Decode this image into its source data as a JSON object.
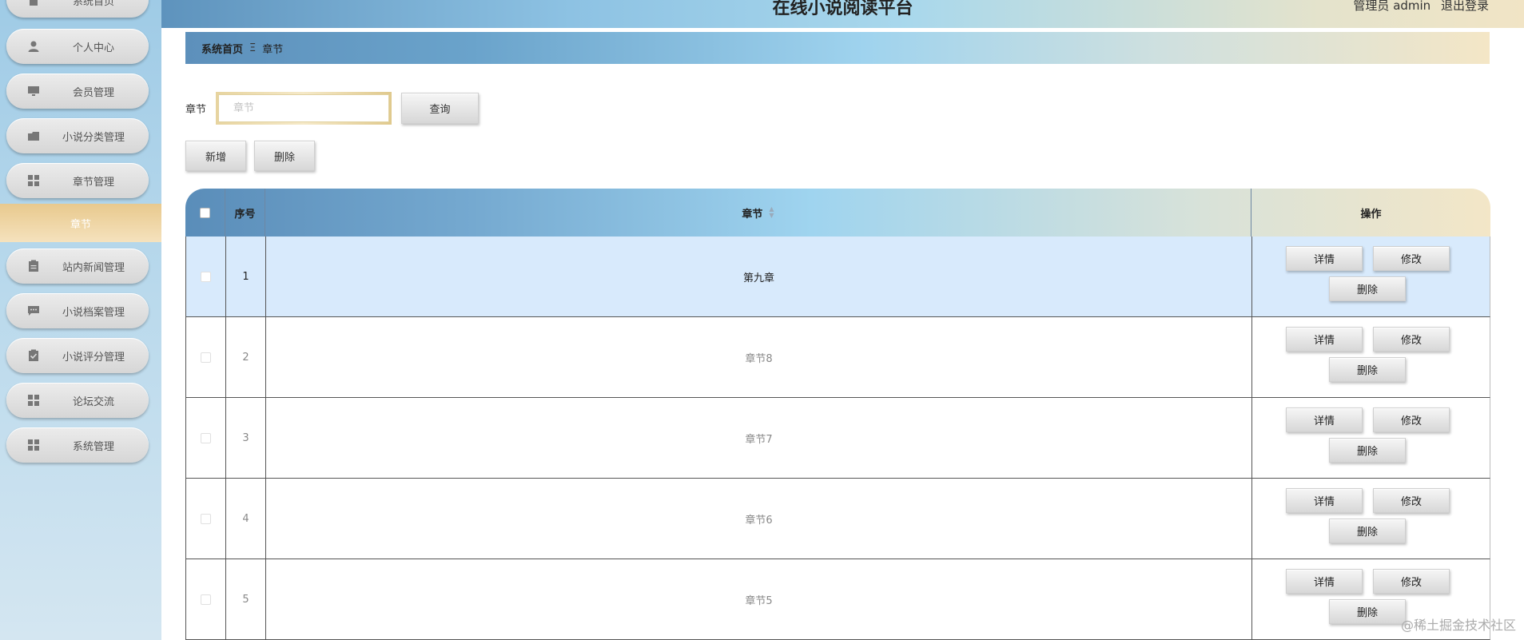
{
  "header": {
    "title": "在线小说阅读平台",
    "role": "管理员 admin",
    "logout": "退出登录"
  },
  "sidebar": {
    "items": [
      {
        "label": "系统首页",
        "icon": "home-icon"
      },
      {
        "label": "个人中心",
        "icon": "person-icon"
      },
      {
        "label": "会员管理",
        "icon": "monitor-icon"
      },
      {
        "label": "小说分类管理",
        "icon": "folder-icon"
      },
      {
        "label": "章节管理",
        "icon": "grid-icon"
      },
      {
        "label": "章节",
        "icon": ""
      },
      {
        "label": "站内新闻管理",
        "icon": "clipboard-icon"
      },
      {
        "label": "小说档案管理",
        "icon": "chat-icon"
      },
      {
        "label": "小说评分管理",
        "icon": "clipboard-check-icon"
      },
      {
        "label": "论坛交流",
        "icon": "grid-icon"
      },
      {
        "label": "系统管理",
        "icon": "grid-icon"
      }
    ]
  },
  "breadcrumb": {
    "home": "系统首页",
    "separator": "Ξ",
    "current": "章节"
  },
  "search": {
    "label": "章节",
    "placeholder": "章节",
    "value": "",
    "button": "查询"
  },
  "actions": {
    "add": "新增",
    "delete": "删除"
  },
  "table": {
    "columns": {
      "index": "序号",
      "chapter": "章节",
      "operation": "操作"
    },
    "rows": [
      {
        "index": "1",
        "chapter": "第九章",
        "selected": true
      },
      {
        "index": "2",
        "chapter": "章节8",
        "selected": false
      },
      {
        "index": "3",
        "chapter": "章节7",
        "selected": false
      },
      {
        "index": "4",
        "chapter": "章节6",
        "selected": false
      },
      {
        "index": "5",
        "chapter": "章节5",
        "selected": false
      }
    ],
    "row_actions": {
      "detail": "详情",
      "edit": "修改",
      "delete": "删除"
    }
  },
  "watermark": "@稀土掘金技术社区",
  "colors": {
    "sidebar_active": "#e8c98e",
    "selected_row": "#d8eafc",
    "header_start": "#5e93bd",
    "header_end": "#f1e4c5"
  }
}
